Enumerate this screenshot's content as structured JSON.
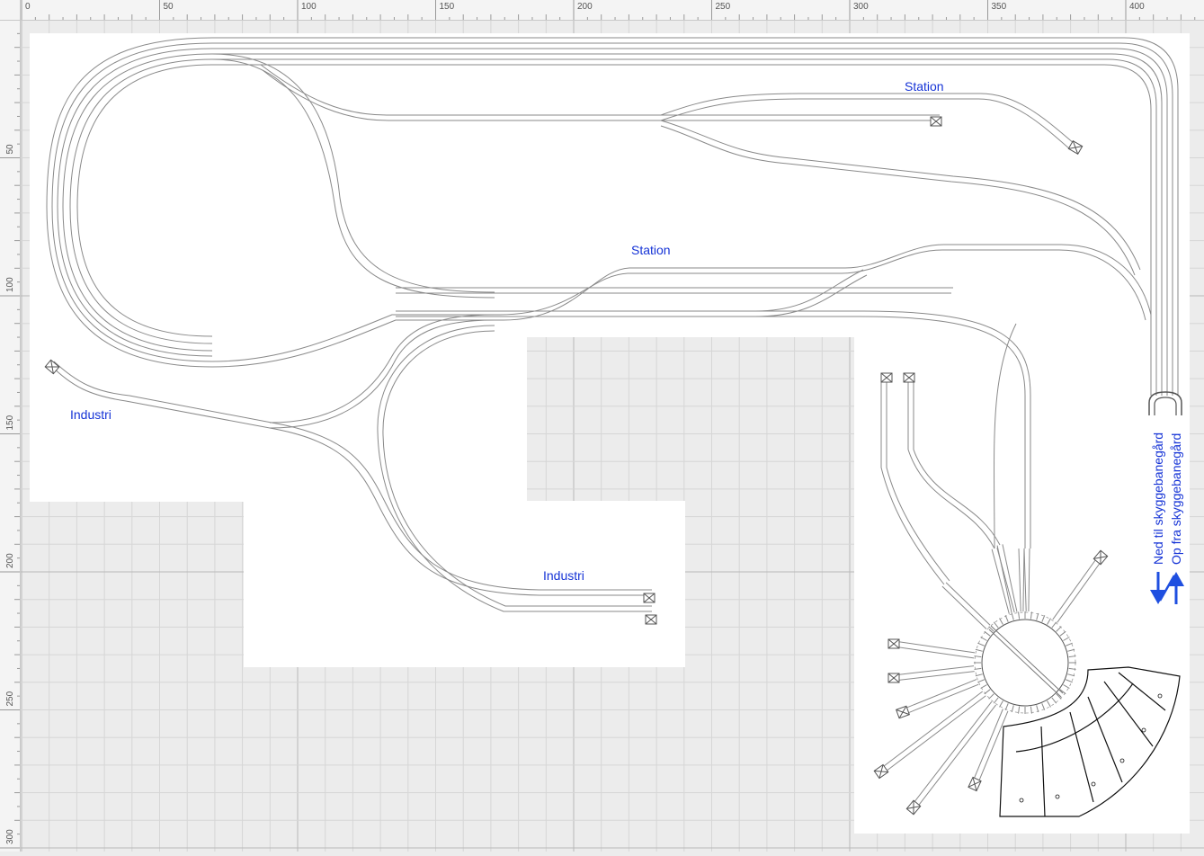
{
  "rulers": {
    "top_ticks": [
      "0",
      "50",
      "100",
      "150",
      "200",
      "250",
      "300",
      "350",
      "400"
    ],
    "left_ticks": [
      "50",
      "100",
      "150",
      "200",
      "250",
      "300"
    ]
  },
  "labels": {
    "station_top": "Station",
    "station_mid": "Station",
    "industri_left": "Industri",
    "industri_bottom": "Industri",
    "ned": "Ned til skyggebanegård",
    "op": "Op fra skyggebanegård"
  },
  "colors": {
    "background": "#ececec",
    "board": "#ffffff",
    "track": "#8a8a8a",
    "label": "#1533d6",
    "arrow": "#1f4fe0",
    "grid": "#d6d6d6",
    "grid_major": "#b8b8b8"
  },
  "icons": {
    "buffer_stop": "buffer-stop-icon",
    "turntable": "turntable-icon",
    "arrow": "arrow-icon"
  }
}
